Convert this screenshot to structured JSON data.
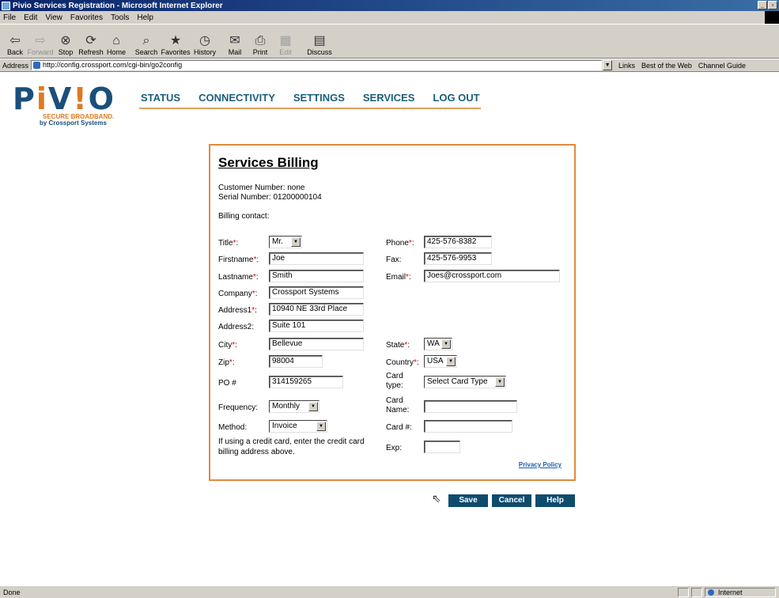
{
  "window": {
    "title": "Pivio Services Registration - Microsoft Internet Explorer",
    "minimize": "_",
    "close": "×"
  },
  "menu": [
    "File",
    "Edit",
    "View",
    "Favorites",
    "Tools",
    "Help"
  ],
  "toolbar": [
    {
      "label": "Back",
      "icon": "back-arrow-icon",
      "glyph": "⇦",
      "disabled": false
    },
    {
      "label": "Forward",
      "icon": "forward-arrow-icon",
      "glyph": "⇨",
      "disabled": true
    },
    {
      "label": "Stop",
      "icon": "stop-icon",
      "glyph": "⊗",
      "disabled": false
    },
    {
      "label": "Refresh",
      "icon": "refresh-icon",
      "glyph": "⟳",
      "disabled": false
    },
    {
      "label": "Home",
      "icon": "home-icon",
      "glyph": "⌂",
      "disabled": false
    },
    {
      "label": "Search",
      "icon": "search-icon",
      "glyph": "⌕",
      "disabled": false
    },
    {
      "label": "Favorites",
      "icon": "favorites-icon",
      "glyph": "★",
      "disabled": false
    },
    {
      "label": "History",
      "icon": "history-icon",
      "glyph": "◷",
      "disabled": false
    },
    {
      "label": "Mail",
      "icon": "mail-icon",
      "glyph": "✉",
      "disabled": false
    },
    {
      "label": "Print",
      "icon": "print-icon",
      "glyph": "⎙",
      "disabled": false
    },
    {
      "label": "Edit",
      "icon": "edit-icon",
      "glyph": "▦",
      "disabled": true
    },
    {
      "label": "Discuss",
      "icon": "discuss-icon",
      "glyph": "▤",
      "disabled": false
    }
  ],
  "address": {
    "label": "Address",
    "url": "http://config.crossport.com/cgi-bin/go2config",
    "links_label": "Links",
    "links": [
      "Best of the Web",
      "Channel Guide"
    ]
  },
  "logo": {
    "word_a": "P",
    "word_i": "i",
    "word_v": "V",
    "word_bang": "!",
    "word_o": "O",
    "tagline": "SECURE BROADBAND.",
    "byline": "by Crossport Systems"
  },
  "nav": [
    "STATUS",
    "CONNECTIVITY",
    "SETTINGS",
    "SERVICES",
    "LOG OUT"
  ],
  "form": {
    "title": "Services Billing",
    "customer_number": "Customer Number: none",
    "serial_number": "Serial Number: 01200000104",
    "billing_contact": "Billing contact:",
    "required_mark": "*",
    "labels": {
      "title": "Title",
      "firstname": "Firstname",
      "lastname": "Lastname",
      "company": "Company",
      "address1": "Address1",
      "address2": "Address2:",
      "city": "City",
      "zip": "Zip",
      "po": "PO #",
      "frequency": "Frequency:",
      "method": "Method:",
      "phone": "Phone",
      "fax": "Fax:",
      "email": "Email",
      "state": "State",
      "country": "Country",
      "card_type_1": "Card",
      "card_type_2": "type:",
      "card_name_1": "Card",
      "card_name_2": "Name:",
      "card_number": "Card #:",
      "exp": "Exp:"
    },
    "colon": ":",
    "values": {
      "title": "Mr.",
      "firstname": "Joe",
      "lastname": "Smith",
      "company": "Crossport Systems",
      "address1": "10940 NE 33rd Place",
      "address2": "Suite 101",
      "city": "Bellevue",
      "zip": "98004",
      "po": "314159265",
      "frequency": "Monthly",
      "method": "Invoice",
      "phone": "425-576-8382",
      "fax": "425-576-9953",
      "email": "Joes@crossport.com",
      "state": "WA",
      "country": "USA",
      "card_type": "Select Card Type",
      "card_name": "",
      "card_number": "",
      "exp": ""
    },
    "note_line1": "If using a credit card, enter the credit card",
    "note_line2": "billing address above.",
    "privacy": "Privacy Policy"
  },
  "buttons": {
    "save": "Save",
    "cancel": "Cancel",
    "help": "Help"
  },
  "status": {
    "text": "Done",
    "zone": "Internet"
  }
}
